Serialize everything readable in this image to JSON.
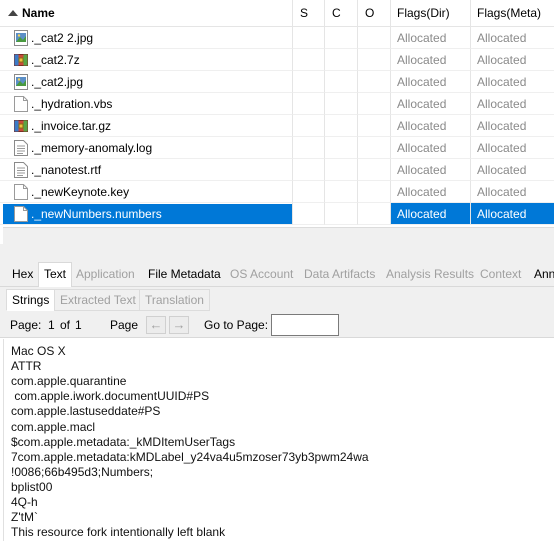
{
  "table": {
    "headers": {
      "name": "Name",
      "s": "S",
      "c": "C",
      "o": "O",
      "flags_dir": "Flags(Dir)",
      "flags_meta": "Flags(Meta)"
    },
    "rows": [
      {
        "name": "._cat2 2.jpg",
        "icon": "image-file-icon",
        "flags_dir": "Allocated",
        "flags_meta": "Allocated",
        "selected": false
      },
      {
        "name": "._cat2.7z",
        "icon": "archive-file-icon",
        "flags_dir": "Allocated",
        "flags_meta": "Allocated",
        "selected": false
      },
      {
        "name": "._cat2.jpg",
        "icon": "image-file-icon",
        "flags_dir": "Allocated",
        "flags_meta": "Allocated",
        "selected": false
      },
      {
        "name": "._hydration.vbs",
        "icon": "blank-file-icon",
        "flags_dir": "Allocated",
        "flags_meta": "Allocated",
        "selected": false
      },
      {
        "name": "._invoice.tar.gz",
        "icon": "archive-file-icon",
        "flags_dir": "Allocated",
        "flags_meta": "Allocated",
        "selected": false
      },
      {
        "name": "._memory-anomaly.log",
        "icon": "text-file-icon",
        "flags_dir": "Allocated",
        "flags_meta": "Allocated",
        "selected": false
      },
      {
        "name": "._nanotest.rtf",
        "icon": "text-file-icon",
        "flags_dir": "Allocated",
        "flags_meta": "Allocated",
        "selected": false
      },
      {
        "name": "._newKeynote.key",
        "icon": "blank-file-icon",
        "flags_dir": "Allocated",
        "flags_meta": "Allocated",
        "selected": false
      },
      {
        "name": "._newNumbers.numbers",
        "icon": "blank-file-icon",
        "flags_dir": "Allocated",
        "flags_meta": "Allocated",
        "selected": true
      }
    ]
  },
  "tabs": [
    {
      "label": "Hex",
      "state": "enabled"
    },
    {
      "label": "Text",
      "state": "active"
    },
    {
      "label": "Application",
      "state": "disabled"
    },
    {
      "label": "File Metadata",
      "state": "enabled"
    },
    {
      "label": "OS Account",
      "state": "disabled"
    },
    {
      "label": "Data Artifacts",
      "state": "disabled"
    },
    {
      "label": "Analysis Results",
      "state": "disabled"
    },
    {
      "label": "Context",
      "state": "disabled"
    },
    {
      "label": "Ann",
      "state": "enabled"
    }
  ],
  "subtabs": [
    {
      "label": "Strings",
      "state": "active"
    },
    {
      "label": "Extracted Text",
      "state": "disabled"
    },
    {
      "label": "Translation",
      "state": "disabled"
    }
  ],
  "pagebar": {
    "page_label": "Page:",
    "page_current": "1",
    "page_of": "of",
    "page_total": "1",
    "page_nav_label": "Page",
    "prev_glyph": "←",
    "next_glyph": "→",
    "goto_label": "Go to Page:",
    "goto_value": ""
  },
  "strings": [
    "Mac OS X",
    "ATTR",
    "com.apple.quarantine",
    " com.apple.iwork.documentUUID#PS",
    "com.apple.lastuseddate#PS",
    "com.apple.macl",
    "$com.apple.metadata:_kMDItemUserTags",
    "7com.apple.metadata:kMDLabel_y24va4u5mzoser73yb3pwm24wa",
    "!0086;66b495d3;Numbers;",
    "bplist00",
    "4Q-h",
    "Z'tM`",
    "This resource fork intentionally left blank"
  ],
  "colors": {
    "selection": "#0078d7",
    "disabled_text": "#a0a0a0",
    "flag_text": "#8a8a8a"
  }
}
